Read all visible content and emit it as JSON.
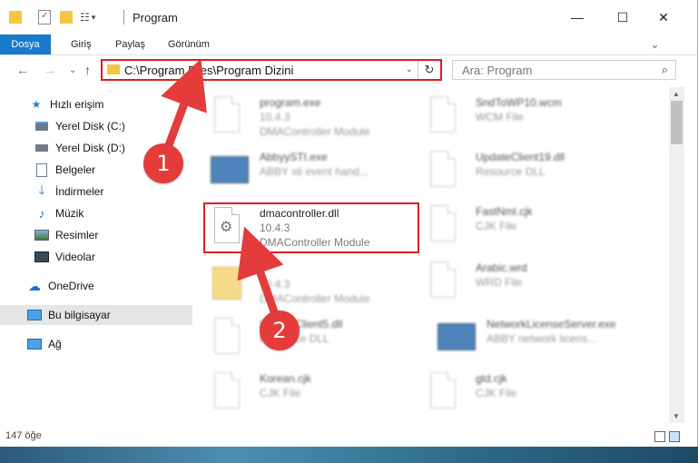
{
  "window": {
    "title": "Program",
    "minimize": "—",
    "maximize": "☐",
    "close": "✕"
  },
  "ribbon": {
    "tabs": [
      "Dosya",
      "Giriş",
      "Paylaş",
      "Görünüm"
    ],
    "active": "Dosya",
    "collapse": "⌄",
    "help": "?"
  },
  "address": {
    "path": "C:\\Program Files\\Program Dizini",
    "dropdown": "⌄",
    "refresh": "↻",
    "back": "←",
    "forward": "→",
    "recent": "⌄",
    "up": "↑"
  },
  "search": {
    "placeholder": "Ara: Program"
  },
  "sidebar": {
    "items": [
      {
        "label": "Hızlı erişim",
        "icon": "star-icon"
      },
      {
        "label": "Yerel Disk (C:)",
        "icon": "drive-icon"
      },
      {
        "label": "Yerel Disk (D:)",
        "icon": "drive-icon"
      },
      {
        "label": "Belgeler",
        "icon": "documents-icon"
      },
      {
        "label": "İndirmeler",
        "icon": "download-icon"
      },
      {
        "label": "Müzik",
        "icon": "music-icon"
      },
      {
        "label": "Resimler",
        "icon": "pictures-icon"
      },
      {
        "label": "Videolar",
        "icon": "videos-icon"
      },
      {
        "label": "OneDrive",
        "icon": "cloud-icon"
      },
      {
        "label": "Bu bilgisayar",
        "icon": "computer-icon"
      },
      {
        "label": "Ağ",
        "icon": "network-icon"
      }
    ],
    "selected": "Bu bilgisayar"
  },
  "files": {
    "left": [
      {
        "name": "program.exe",
        "line2": "10.4.3",
        "line3": "DMAController Module"
      },
      {
        "name": "AbbyySTI.exe",
        "line2": "ABBY sti event hand...",
        "line3": ""
      },
      {
        "name": "dmacontroller.dll",
        "line2": "10.4.3",
        "line3": "DMAController Module"
      },
      {
        "name": "",
        "line2": "10.4.3",
        "line3": "DMAController Module"
      },
      {
        "name": "UpdateClient5.dll",
        "line2": "Resource DLL",
        "line3": ""
      },
      {
        "name": "Korean.cjk",
        "line2": "CJK File",
        "line3": ""
      }
    ],
    "right": [
      {
        "name": "SndToWP10.wcm",
        "line2": "WCM File",
        "line3": ""
      },
      {
        "name": "UpdateClient19.dll",
        "line2": "Resource DLL",
        "line3": ""
      },
      {
        "name": "FastNml.cjk",
        "line2": "CJK File",
        "line3": ""
      },
      {
        "name": "Arabic.wrd",
        "line2": "WRD File",
        "line3": ""
      },
      {
        "name": "NetworkLicenseServer.exe",
        "line2": "ABBY network licens...",
        "line3": ""
      },
      {
        "name": "gtd.cjk",
        "line2": "CJK File",
        "line3": ""
      }
    ]
  },
  "annotations": {
    "step1": "1",
    "step2": "2",
    "color": "#e43b3b"
  },
  "status": {
    "count": "147 öğe"
  },
  "colors": {
    "accent": "#1979ca",
    "highlight": "#e11c1c"
  }
}
